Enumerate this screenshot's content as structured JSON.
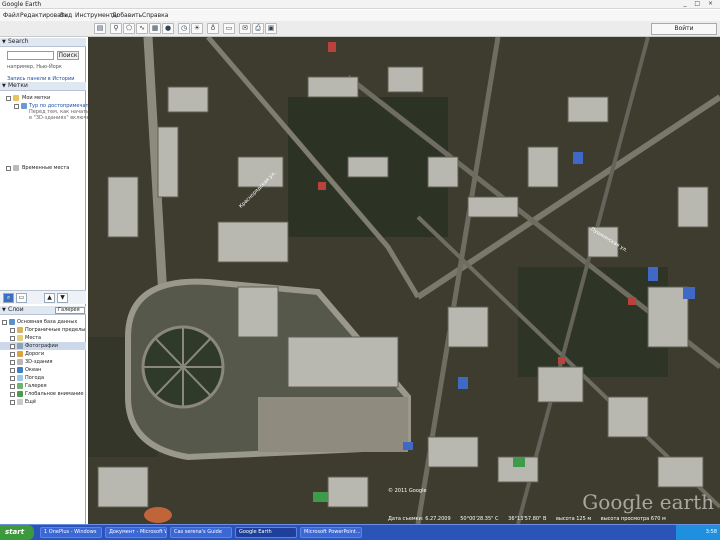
{
  "window": {
    "title": "Google Earth",
    "controls": "_ □ ×"
  },
  "menu": {
    "items": [
      "Файл",
      "Редактировать",
      "Вид",
      "Инструменты",
      "Добавить",
      "Справка"
    ]
  },
  "toolbar": {
    "icons": [
      "sidebar-toggle-icon",
      "placemark-icon",
      "polygon-icon",
      "path-icon",
      "image-overlay-icon",
      "record-tour-icon",
      "historical-imagery-icon",
      "sunlight-icon",
      "planets-icon",
      "ruler-icon",
      "email-icon",
      "print-icon",
      "view-in-maps-icon"
    ],
    "sign_in": "Войти"
  },
  "search": {
    "header": "Search",
    "input_value": "",
    "button": "Поиск",
    "hint": "например, Нью-Йорк",
    "history_link": "Запись панели в Истории"
  },
  "places": {
    "header": "Метки",
    "items": [
      {
        "label": "Мои метки"
      },
      {
        "label": "Тур по достопримечательностям"
      },
      {
        "label": "Перед тем, как начать тур, убедитесь, что"
      },
      {
        "label": "в \"3D-зданиях\" включен"
      },
      {
        "label": "Временные места"
      }
    ]
  },
  "layers": {
    "header": "Слои",
    "gallery": "Галерея",
    "items": [
      {
        "label": "Основная база данных"
      },
      {
        "label": "Пограничные пределы"
      },
      {
        "label": "Места"
      },
      {
        "label": "Фотографии"
      },
      {
        "label": "Дороги"
      },
      {
        "label": "3D-здания"
      },
      {
        "label": "Океан"
      },
      {
        "label": "Погода"
      },
      {
        "label": "Галерея"
      },
      {
        "label": "Глобальное внимание"
      },
      {
        "label": "Ещё"
      }
    ]
  },
  "map": {
    "logo": "Google earth",
    "copyright": "© 2011 Google",
    "street_1": "Краснорядская ул.",
    "street_2": "Пушкинская ул.",
    "status": {
      "date": "Дата съемки: 6.27.2009",
      "lat": "50°00'28.35\" С",
      "lon": "36°13'57.80\" В",
      "elev": "высота 125 м",
      "eye": "высота просмотра 670 м"
    }
  },
  "taskbar": {
    "start": "start",
    "tasks": [
      "1 OnePlus - Windows",
      "Документ - Microsoft Word",
      "Cas serena's Guide",
      "Google Earth",
      "Microsoft PowerPoint..."
    ],
    "clock": "3:58"
  }
}
